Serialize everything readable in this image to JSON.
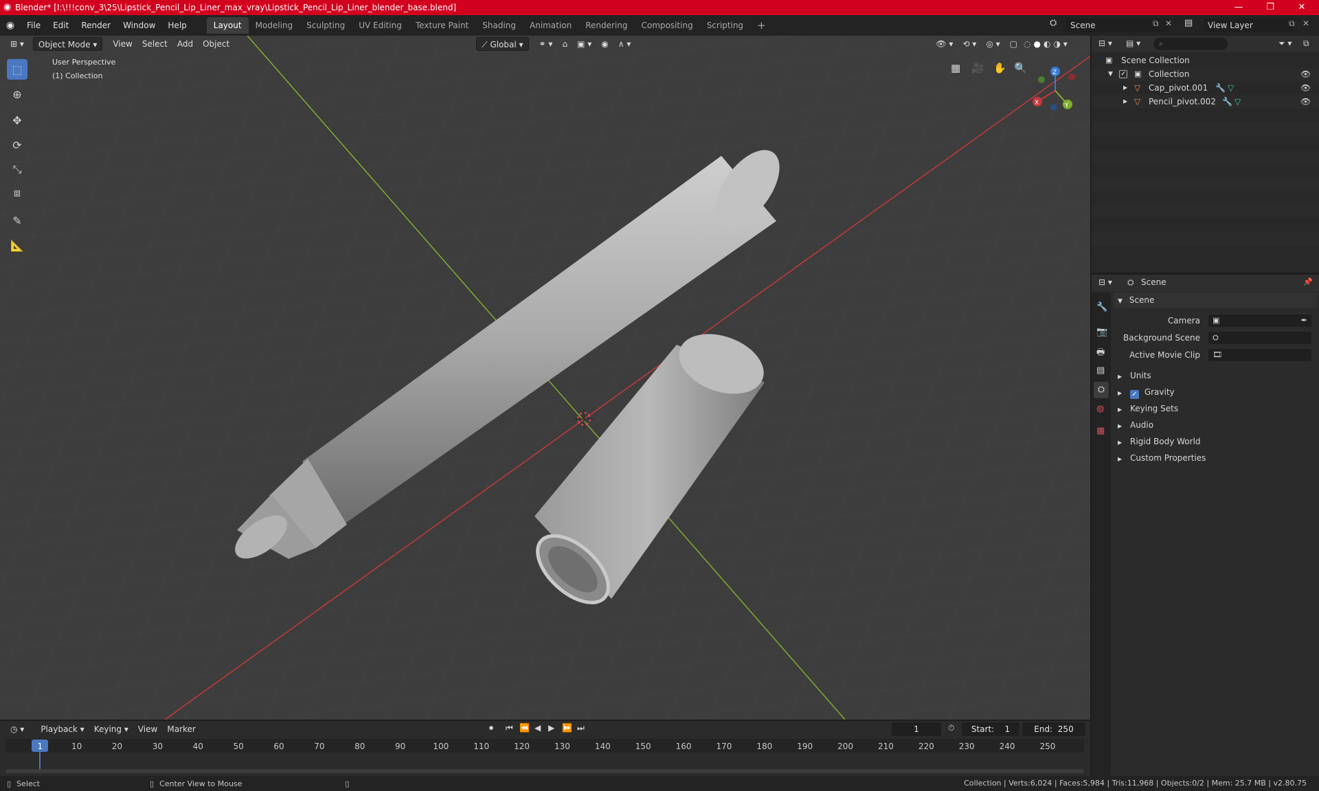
{
  "window": {
    "title": "Blender* [I:\\!!!conv_3\\25\\Lipstick_Pencil_Lip_Liner_max_vray\\Lipstick_Pencil_Lip_Liner_blender_base.blend]",
    "minimize": "—",
    "maximize": "❐",
    "close": "✕"
  },
  "menu": {
    "items": [
      "File",
      "Edit",
      "Render",
      "Window",
      "Help"
    ],
    "workspaces": [
      "Layout",
      "Modeling",
      "Sculpting",
      "UV Editing",
      "Texture Paint",
      "Shading",
      "Animation",
      "Rendering",
      "Compositing",
      "Scripting"
    ],
    "active_workspace": "Layout",
    "add_tab": "+",
    "scene_label": "Scene",
    "view_layer_label": "View Layer"
  },
  "viewport": {
    "mode": "Object Mode",
    "menus": [
      "View",
      "Select",
      "Add",
      "Object"
    ],
    "orientation": "Global",
    "overlay_line1": "User Perspective",
    "overlay_line2": "(1) Collection",
    "gizmo_x": "X",
    "gizmo_y": "Y",
    "gizmo_z": "Z",
    "tools": [
      "select-box",
      "cursor",
      "move",
      "rotate",
      "scale",
      "transform",
      "annotate",
      "measure"
    ]
  },
  "outliner": {
    "search_placeholder": "",
    "root": "Scene Collection",
    "collection": "Collection",
    "objects": [
      "Cap_pivot.001",
      "Pencil_pivot.002"
    ]
  },
  "properties": {
    "header": "Scene",
    "panel": "Scene",
    "camera_label": "Camera",
    "background_scene_label": "Background Scene",
    "active_movie_clip_label": "Active Movie Clip",
    "sections": [
      "Units",
      "Gravity",
      "Keying Sets",
      "Audio",
      "Rigid Body World",
      "Custom Properties"
    ],
    "gravity_checked": true
  },
  "timeline": {
    "menus": [
      "Playback",
      "Keying",
      "View",
      "Marker"
    ],
    "current_frame": "1",
    "start_label": "Start:",
    "start_value": "1",
    "end_label": "End:",
    "end_value": "250",
    "ruler": [
      "1",
      "10",
      "20",
      "30",
      "40",
      "50",
      "60",
      "70",
      "80",
      "90",
      "100",
      "110",
      "120",
      "130",
      "140",
      "150",
      "160",
      "170",
      "180",
      "190",
      "200",
      "210",
      "220",
      "230",
      "240",
      "250"
    ]
  },
  "status": {
    "left_action": "Select",
    "middle_action": "Center View to Mouse",
    "stats": "Collection | Verts:6,024 | Faces:5,984 | Tris:11,968 | Objects:0/2 | Mem: 25.7 MB | v2.80.75"
  },
  "colors": {
    "accent": "#4a78c2",
    "title_bar": "#d2001e",
    "x_axis": "#c8383c",
    "y_axis": "#7fae2e",
    "z_axis": "#3a7cd6"
  }
}
